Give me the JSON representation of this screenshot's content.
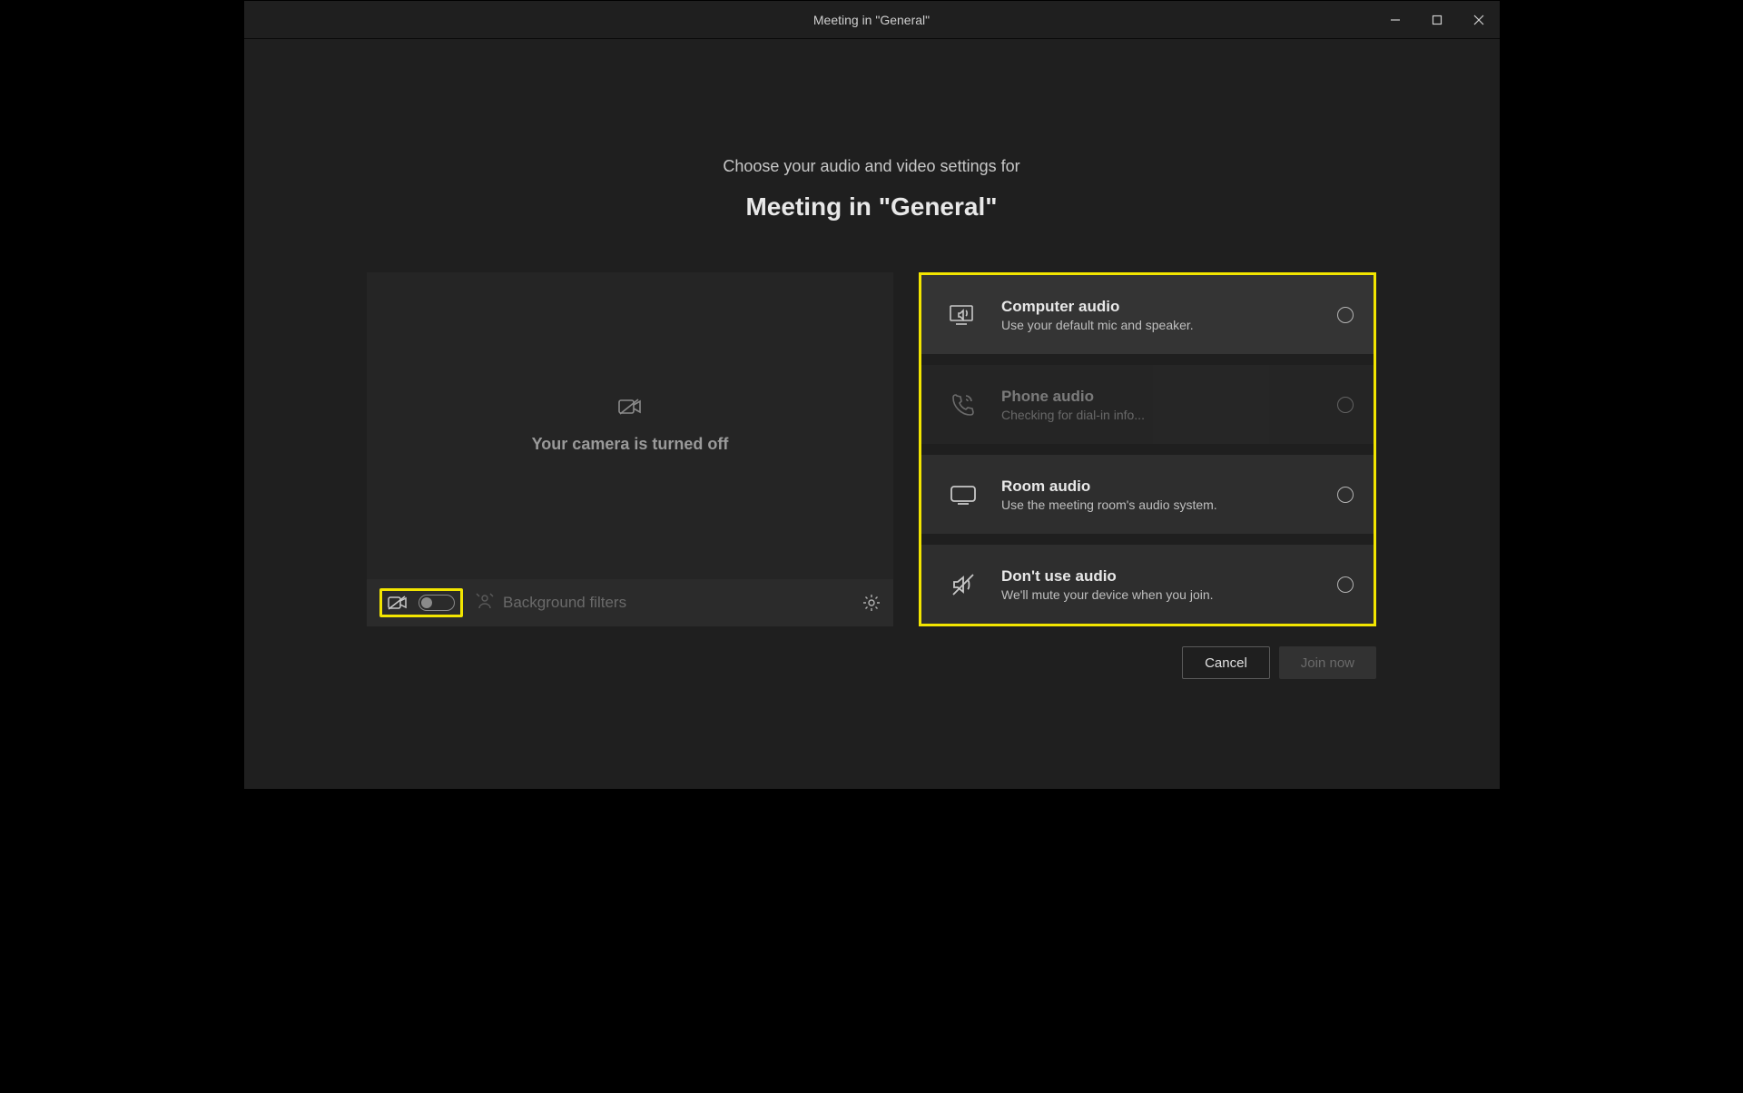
{
  "titlebar": {
    "title": "Meeting in \"General\""
  },
  "prompt": {
    "line": "Choose your audio and video settings for",
    "meeting_name": "Meeting in \"General\""
  },
  "camera": {
    "off_text": "Your camera is turned off",
    "bg_filters_label": "Background filters"
  },
  "audio_options": [
    {
      "key": "computer",
      "title": "Computer audio",
      "desc": "Use your default mic and speaker.",
      "icon": "computer-audio-icon",
      "state": "active"
    },
    {
      "key": "phone",
      "title": "Phone audio",
      "desc": "Checking for dial-in info...",
      "icon": "phone-audio-icon",
      "state": "disabled"
    },
    {
      "key": "room",
      "title": "Room audio",
      "desc": "Use the meeting room's audio system.",
      "icon": "room-audio-icon",
      "state": "normal"
    },
    {
      "key": "none",
      "title": "Don't use audio",
      "desc": "We'll mute your device when you join.",
      "icon": "no-audio-icon",
      "state": "normal"
    }
  ],
  "actions": {
    "cancel": "Cancel",
    "join": "Join now"
  },
  "highlight_color": "#f2e500"
}
